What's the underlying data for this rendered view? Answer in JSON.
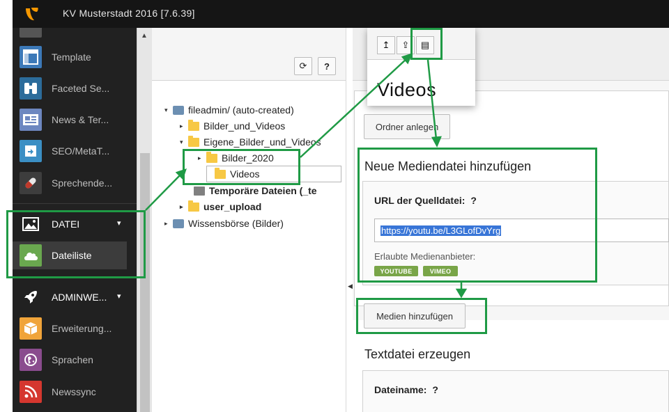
{
  "window": {
    "title": "KV Musterstadt 2016 [7.6.39]"
  },
  "module_menu": {
    "items": [
      {
        "label": "Template",
        "icon": "template-icon",
        "color": "#3c79b8"
      },
      {
        "label": "Faceted Se...",
        "icon": "binoculars-icon",
        "color": "#2c6c9b"
      },
      {
        "label": "News & Ter...",
        "icon": "news-icon",
        "color": "#6d87c0"
      },
      {
        "label": "SEO/MetaT...",
        "icon": "seo-icon",
        "color": "#3b8fc4"
      },
      {
        "label": "Sprechende...",
        "icon": "pill-icon",
        "color": "#3d3d3d"
      }
    ],
    "datei_group": {
      "label": "DATEI",
      "icon": "image-icon"
    },
    "dateiliste": {
      "label": "Dateiliste",
      "icon": "cloud-icon",
      "color": "#6aa84f"
    },
    "admin_group": {
      "label": "ADMINWE...",
      "icon": "rocket-icon"
    },
    "admin_items": [
      {
        "label": "Erweiterung...",
        "icon": "box-icon",
        "color": "#f0a43a"
      },
      {
        "label": "Sprachen",
        "icon": "globe-icon",
        "color": "#8a4c8e"
      },
      {
        "label": "Newssync",
        "icon": "rss-icon",
        "color": "#d5372f"
      }
    ]
  },
  "tree": {
    "toolbar": {
      "refresh": "⟳",
      "help": "?"
    },
    "nodes": [
      {
        "label": "fileadmin/ (auto-created)"
      },
      {
        "label": "Bilder_und_Videos"
      },
      {
        "label": "Eigene_Bilder_und_Videos"
      },
      {
        "label": "Bilder_2020"
      },
      {
        "label": "Videos"
      },
      {
        "label": "Temporäre Dateien (_te"
      },
      {
        "label": "user_upload"
      },
      {
        "label": "Wissensbörse (Bilder)"
      }
    ]
  },
  "popup": {
    "title": "Videos",
    "buttons": [
      "↥",
      "⇪",
      "▤"
    ]
  },
  "content": {
    "create_folder_button": "Ordner anlegen",
    "media_section": {
      "title": "Neue Mediendatei hinzufügen",
      "url_label": "URL der Quelldatei:",
      "help": "?",
      "url_value": "https://youtu.be/L3GLofDvYrg",
      "providers_label": "Erlaubte Medienanbieter:",
      "providers": [
        "YOUTUBE",
        "VIMEO"
      ]
    },
    "add_media_button": "Medien hinzufügen",
    "textfile_section": {
      "title": "Textdatei erzeugen",
      "filename_label": "Dateiname:",
      "help": "?"
    }
  },
  "colors": {
    "annotation_green": "#1f9a45",
    "accent_orange": "#f49700",
    "badge_green": "#79a548"
  }
}
